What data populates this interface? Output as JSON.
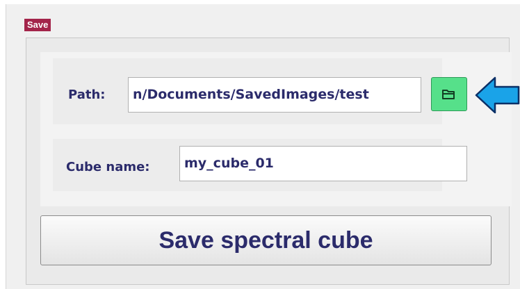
{
  "section": {
    "title": "Save"
  },
  "path": {
    "label": "Path:",
    "value": "n/Documents/SavedImages/test"
  },
  "browse_button": {
    "icon": "folder-open-icon",
    "color": "#56e08a"
  },
  "annotation": {
    "icon": "arrow-left-icon",
    "color": "#1aa3e8"
  },
  "cube_name": {
    "label": "Cube name:",
    "value": "my_cube_01"
  },
  "actions": {
    "save_label": "Save spectral cube"
  },
  "colors": {
    "section_tag": "#a3244a",
    "label_text": "#2b2b6b"
  }
}
